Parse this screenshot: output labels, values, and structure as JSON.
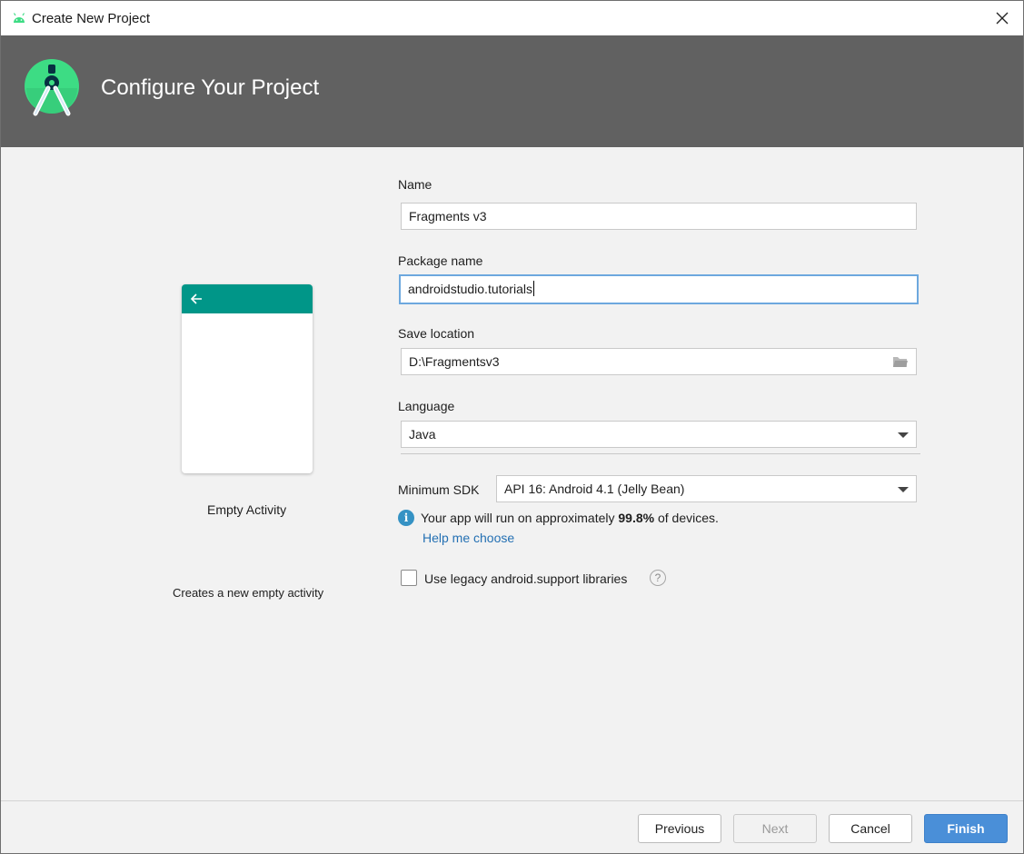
{
  "window": {
    "title": "Create New Project",
    "close_icon": "close-icon",
    "app_icon": "android-icon"
  },
  "header": {
    "title": "Configure Your Project",
    "logo": "android-studio-logo"
  },
  "template": {
    "name": "Empty Activity",
    "description": "Creates a new empty activity",
    "appbar_color": "#009688",
    "back_icon": "arrow-left-icon"
  },
  "form": {
    "name_label": "Name",
    "name_value": "Fragments v3",
    "package_label": "Package name",
    "package_value": "androidstudio.tutorials",
    "location_label": "Save location",
    "location_value": "D:\\Fragmentsv3",
    "location_icon": "folder-icon",
    "language_label": "Language",
    "language_value": "Java",
    "sdk_label": "Minimum SDK",
    "sdk_value": "API 16: Android 4.1 (Jelly Bean)",
    "info_prefix": "Your app will run on approximately ",
    "info_percent": "99.8%",
    "info_suffix": " of devices.",
    "help_link": "Help me choose",
    "legacy_label": "Use legacy android.support libraries",
    "legacy_checked": false
  },
  "footer": {
    "previous": "Previous",
    "next": "Next",
    "cancel": "Cancel",
    "finish": "Finish"
  },
  "colors": {
    "header_bg": "#616161",
    "accent": "#4a8fd8",
    "link": "#2470b3",
    "focus_border": "#6da8de"
  }
}
